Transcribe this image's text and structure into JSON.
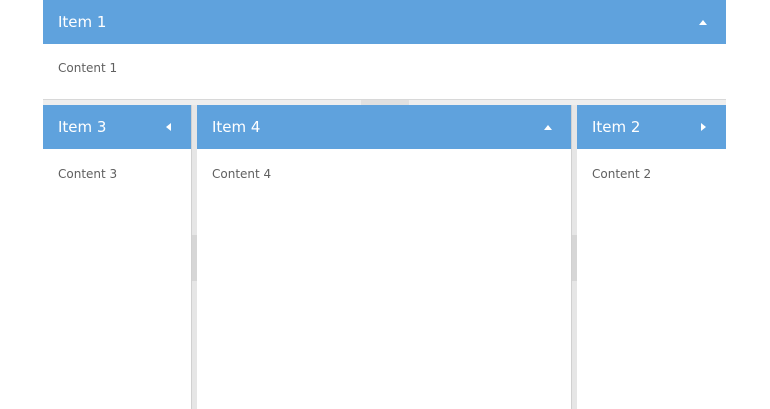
{
  "panels": {
    "item1": {
      "title": "Item 1",
      "content": "Content 1",
      "tool_icon": "collapse-up-icon"
    },
    "item3": {
      "title": "Item 3",
      "content": "Content 3",
      "tool_icon": "collapse-left-icon"
    },
    "item4": {
      "title": "Item 4",
      "content": "Content 4",
      "tool_icon": "collapse-up-icon"
    },
    "item2": {
      "title": "Item 2",
      "content": "Content 2",
      "tool_icon": "expand-right-icon"
    }
  },
  "colors": {
    "header_bg": "#5fa2dd",
    "header_text": "#ffffff",
    "body_text": "#606060",
    "splitter": "#e6e6e6"
  }
}
